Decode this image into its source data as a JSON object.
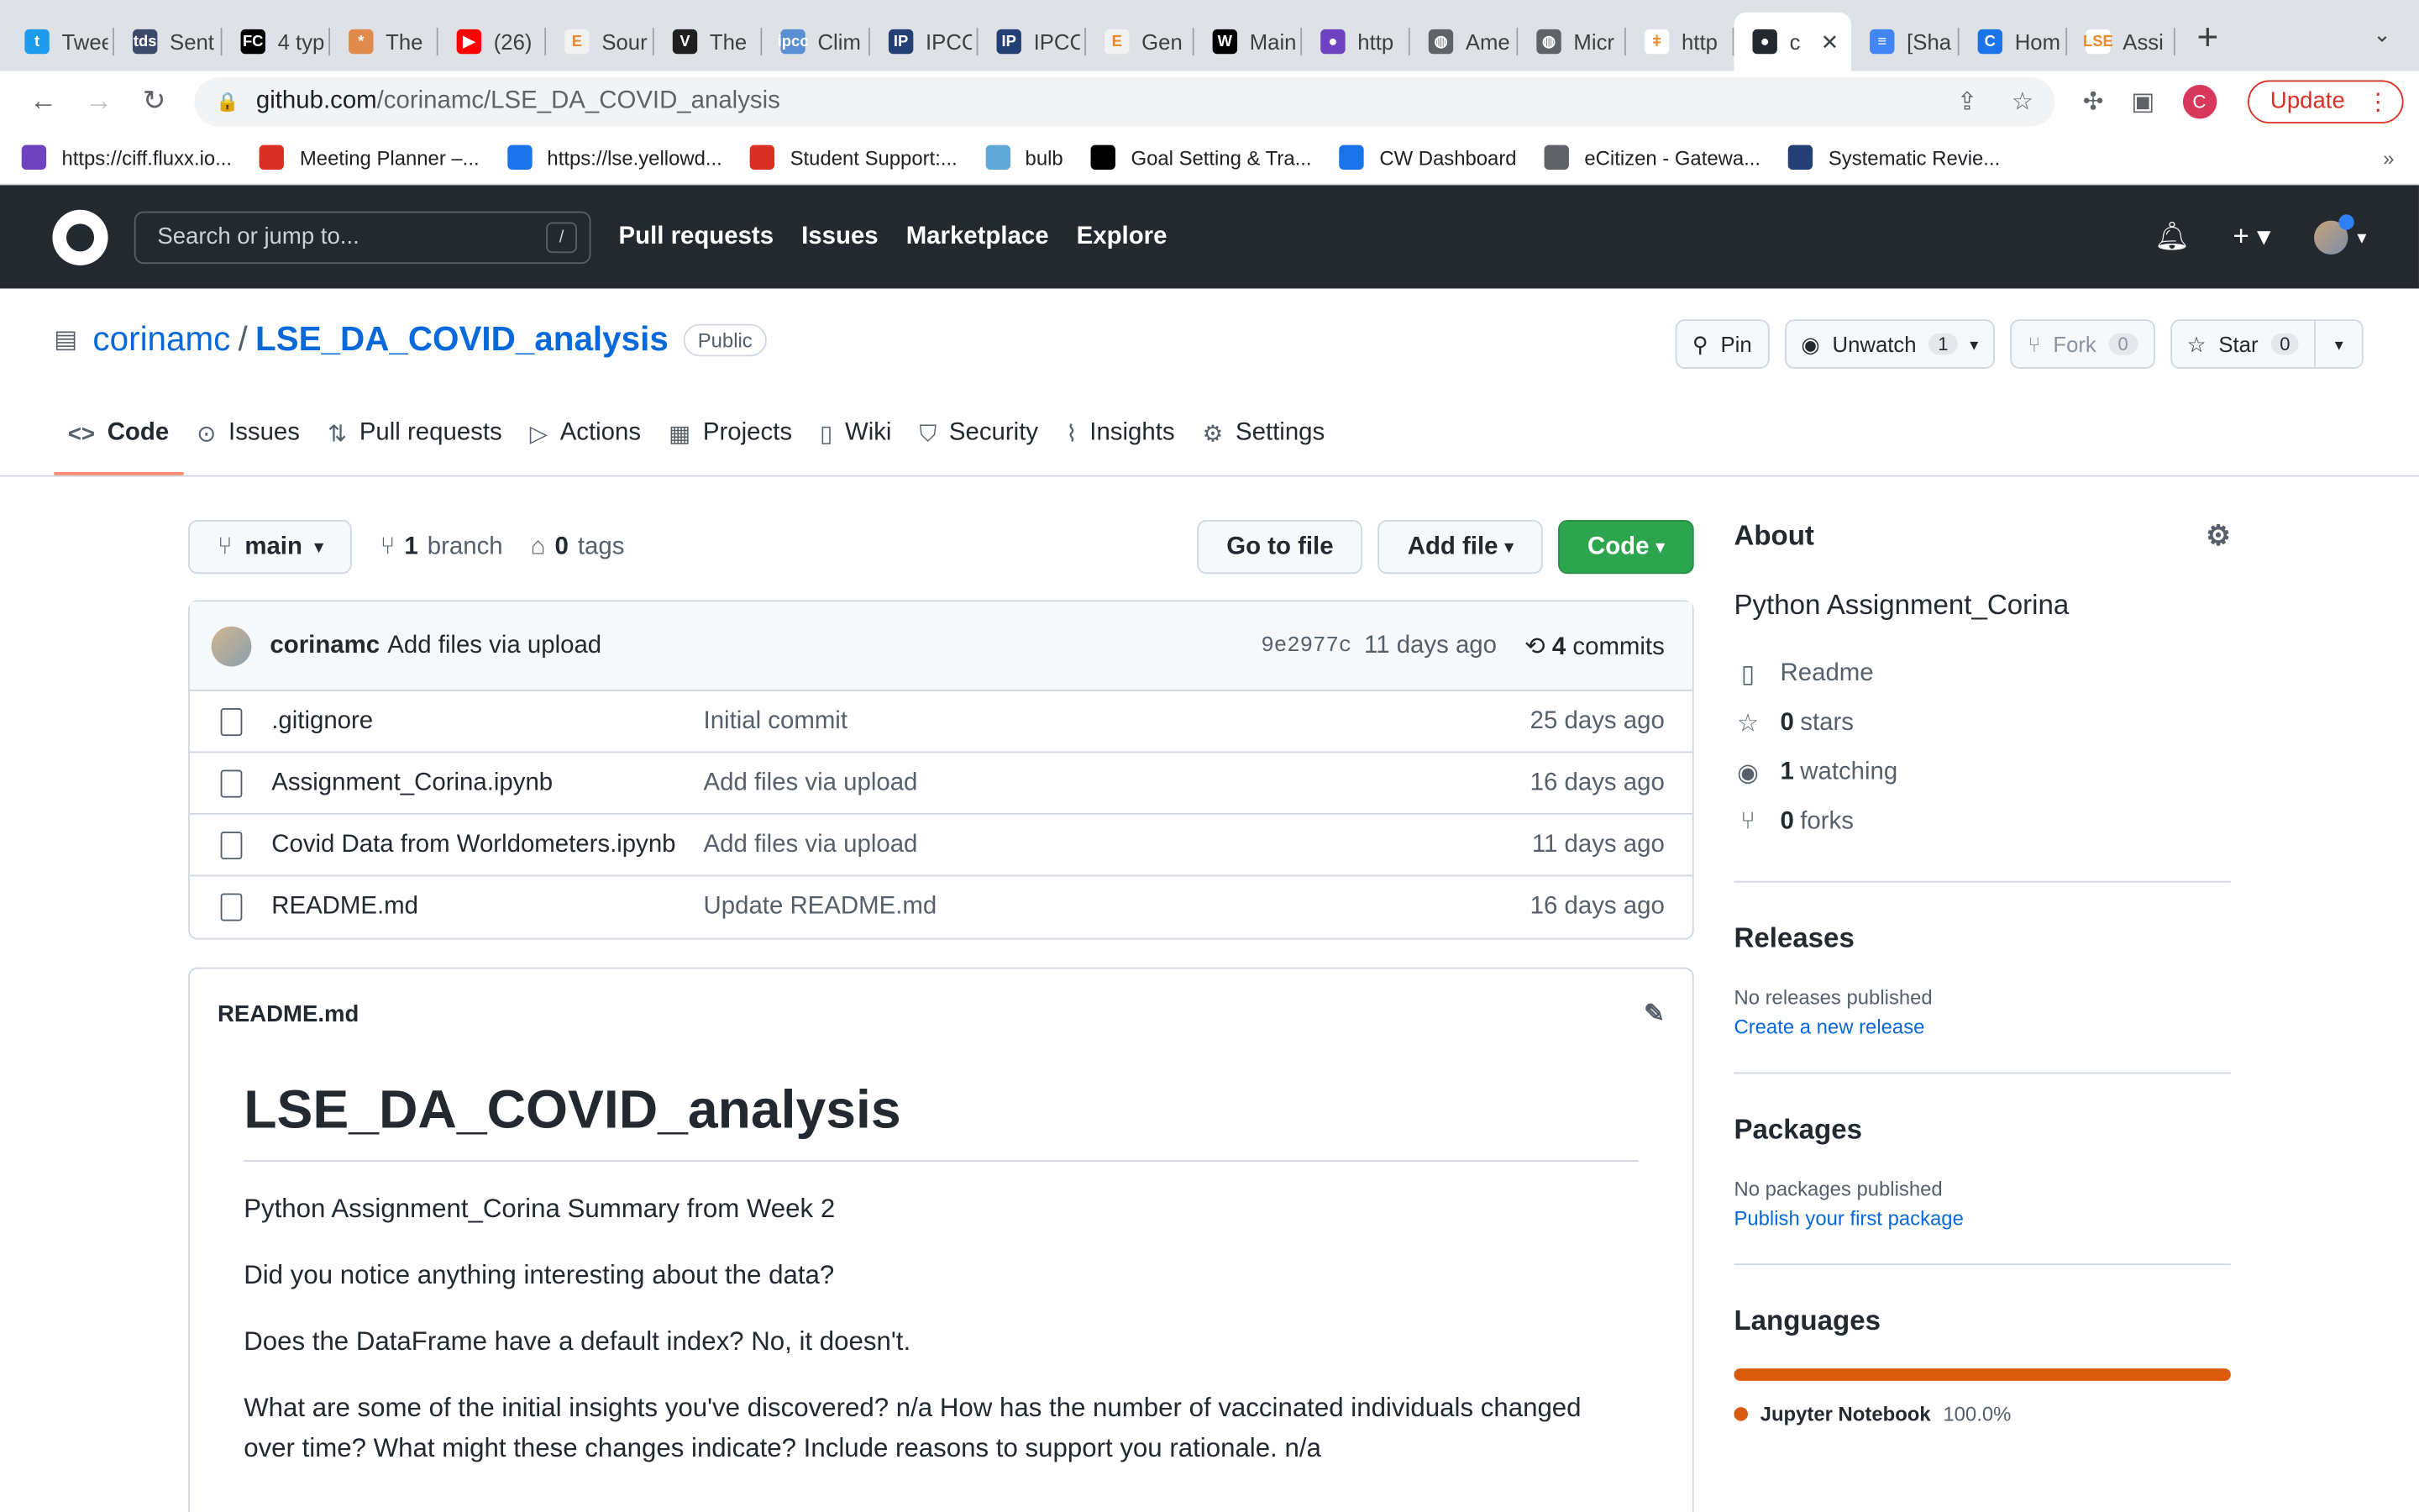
{
  "browser": {
    "tabs": [
      {
        "title": "Twee",
        "fav": "#1d9bf0",
        "glyph": "t"
      },
      {
        "title": "Sent",
        "fav": "#3b4a6b",
        "glyph": "tds"
      },
      {
        "title": "4 typ",
        "fav": "#000000",
        "glyph": "FC"
      },
      {
        "title": "The",
        "fav": "#e08a4b",
        "glyph": "*"
      },
      {
        "title": "(26)",
        "fav": "#ff0000",
        "glyph": "▶"
      },
      {
        "title": "Sour",
        "fav": "#f2f2f2",
        "glyph": "E"
      },
      {
        "title": "The",
        "fav": "#1f1f1f",
        "glyph": "V"
      },
      {
        "title": "Clim",
        "fav": "#5b8fd3",
        "glyph": "ipcc"
      },
      {
        "title": "IPCC",
        "fav": "#233f73",
        "glyph": "IP"
      },
      {
        "title": "IPCC",
        "fav": "#233f73",
        "glyph": "IP"
      },
      {
        "title": "Gen",
        "fav": "#f2f2f2",
        "glyph": "E"
      },
      {
        "title": "Main",
        "fav": "#000000",
        "glyph": "W"
      },
      {
        "title": "http",
        "fav": "#6f42c1",
        "glyph": "●"
      },
      {
        "title": "Ame",
        "fav": "#5f6368",
        "glyph": "◍"
      },
      {
        "title": "Micr",
        "fav": "#5f6368",
        "glyph": "◍"
      },
      {
        "title": "http",
        "fav": "#ffffff",
        "glyph": "ǂ"
      },
      {
        "title": "c",
        "fav": "#24292f",
        "glyph": "●",
        "active": true
      },
      {
        "title": "[Sha",
        "fav": "#4285f4",
        "glyph": "≡"
      },
      {
        "title": "Hom",
        "fav": "#1a73e8",
        "glyph": "C"
      },
      {
        "title": "Assi",
        "fav": "#ffffff",
        "glyph": "LSE"
      }
    ],
    "new_tab": "+",
    "url_host": "github.com",
    "url_path": "/corinamc/LSE_DA_COVID_analysis",
    "profile_initial": "C",
    "update_label": "Update",
    "bookmarks": [
      {
        "label": "https://ciff.fluxx.io...",
        "color": "#6f42c1"
      },
      {
        "label": "Meeting Planner –...",
        "color": "#d93025"
      },
      {
        "label": "https://lse.yellowd...",
        "color": "#1a73e8"
      },
      {
        "label": "Student Support:...",
        "color": "#d93025"
      },
      {
        "label": "bulb",
        "color": "#61a8d8"
      },
      {
        "label": "Goal Setting & Tra...",
        "color": "#000000"
      },
      {
        "label": "CW Dashboard",
        "color": "#1a73e8"
      },
      {
        "label": "eCitizen - Gatewa...",
        "color": "#5f6368"
      },
      {
        "label": "Systematic Revie...",
        "color": "#233f73"
      }
    ],
    "bookmarks_more": "»"
  },
  "github": {
    "search_placeholder": "Search or jump to...",
    "search_key": "/",
    "nav": [
      "Pull requests",
      "Issues",
      "Marketplace",
      "Explore"
    ]
  },
  "repo": {
    "owner": "corinamc",
    "separator": "/",
    "name": "LSE_DA_COVID_analysis",
    "visibility": "Public",
    "pin": "Pin",
    "unwatch": "Unwatch",
    "watch_count": "1",
    "fork": "Fork",
    "fork_count": "0",
    "star": "Star",
    "star_count": "0",
    "tabs": [
      {
        "label": "Code",
        "icon": "<>",
        "selected": true
      },
      {
        "label": "Issues",
        "icon": "⊙"
      },
      {
        "label": "Pull requests",
        "icon": "⇅"
      },
      {
        "label": "Actions",
        "icon": "▷"
      },
      {
        "label": "Projects",
        "icon": "▦"
      },
      {
        "label": "Wiki",
        "icon": "▯"
      },
      {
        "label": "Security",
        "icon": "⛉"
      },
      {
        "label": "Insights",
        "icon": "⌇"
      },
      {
        "label": "Settings",
        "icon": "⚙"
      }
    ]
  },
  "files": {
    "branch": "main",
    "branch_count": "1",
    "branch_label": "branch",
    "tag_count": "0",
    "tag_label": "tags",
    "go_to_file": "Go to file",
    "add_file": "Add file",
    "code": "Code",
    "commit_user": "corinamc",
    "commit_msg": "Add files via upload",
    "commit_sha": "9e2977c",
    "commit_ago": "11 days ago",
    "commits_count": "4",
    "commits_label": "commits",
    "rows": [
      {
        "name": ".gitignore",
        "msg": "Initial commit",
        "age": "25 days ago"
      },
      {
        "name": "Assignment_Corina.ipynb",
        "msg": "Add files via upload",
        "age": "16 days ago"
      },
      {
        "name": "Covid Data from Worldometers.ipynb",
        "msg": "Add files via upload",
        "age": "11 days ago"
      },
      {
        "name": "README.md",
        "msg": "Update README.md",
        "age": "16 days ago"
      }
    ]
  },
  "readme": {
    "filename": "README.md",
    "title": "LSE_DA_COVID_analysis",
    "paragraphs": [
      "Python Assignment_Corina Summary from Week 2",
      "Did you notice anything interesting about the data?",
      "Does the DataFrame have a default index? No, it doesn't.",
      "What are some of the initial insights you've discovered? n/a How has the number of vaccinated individuals changed over time? What might these changes indicate? Include reasons to support you rationale. n/a"
    ]
  },
  "about": {
    "heading": "About",
    "description": "Python Assignment_Corina",
    "readme": "Readme",
    "stars_count": "0",
    "stars_label": "stars",
    "watching_count": "1",
    "watching_label": "watching",
    "forks_count": "0",
    "forks_label": "forks",
    "releases_heading": "Releases",
    "releases_none": "No releases published",
    "releases_link": "Create a new release",
    "packages_heading": "Packages",
    "packages_none": "No packages published",
    "packages_link": "Publish your first package",
    "languages_heading": "Languages",
    "language_name": "Jupyter Notebook",
    "language_pct": "100.0%",
    "language_color": "#da5b0b"
  }
}
